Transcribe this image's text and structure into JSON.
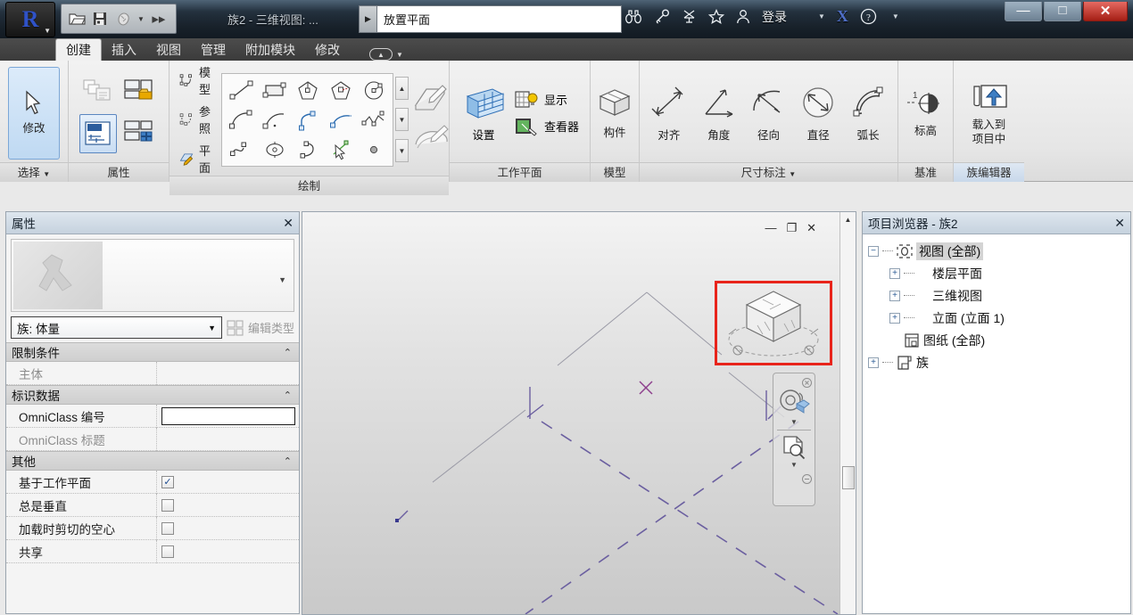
{
  "titlebar": {
    "window_title": "族2 - 三维视图: ...",
    "search_value": "放置平面",
    "signin_label": "登录",
    "quick_access": [
      {
        "name": "open-icon",
        "glyph": "📂"
      },
      {
        "name": "save-icon",
        "glyph": "💾"
      },
      {
        "name": "undo-icon",
        "glyph": "☁"
      }
    ],
    "tools": [
      {
        "name": "search-binoculars-icon",
        "glyph": "🔍"
      },
      {
        "name": "key-icon",
        "glyph": "🔑"
      },
      {
        "name": "satellite-icon",
        "glyph": "⚑"
      },
      {
        "name": "star-icon",
        "glyph": "☆"
      },
      {
        "name": "user-icon",
        "glyph": "👤"
      }
    ],
    "exchange_label": "X",
    "help_label": "?",
    "window_buttons": {
      "minimize": "—",
      "maximize": "□",
      "close": "✕"
    }
  },
  "ribbon": {
    "tabs": [
      {
        "label": "创建",
        "active": true
      },
      {
        "label": "插入",
        "active": false
      },
      {
        "label": "视图",
        "active": false
      },
      {
        "label": "管理",
        "active": false
      },
      {
        "label": "附加模块",
        "active": false
      },
      {
        "label": "修改",
        "active": false
      }
    ],
    "panels": {
      "select": {
        "label": "选择",
        "has_dropdown": true,
        "modify_button": "修改"
      },
      "properties": {
        "label": "属性"
      },
      "draw": {
        "label": "绘制",
        "items": [
          {
            "label": "模型",
            "icon": "model-line-icon"
          },
          {
            "label": "参照",
            "icon": "reference-line-icon"
          },
          {
            "label": "平面",
            "icon": "plane-icon"
          }
        ]
      },
      "workplane": {
        "label": "工作平面",
        "set_label": "设置",
        "show_label": "显示",
        "viewer_label": "查看器"
      },
      "model": {
        "label": "模型",
        "component_label": "构件"
      },
      "dimension": {
        "label": "尺寸标注",
        "has_dropdown": true,
        "items": [
          "对齐",
          "角度",
          "径向",
          "直径",
          "弧长"
        ]
      },
      "datum": {
        "label": "基准",
        "level_label": "标高"
      },
      "family_editor": {
        "label": "族编辑器",
        "load_label_line1": "载入到",
        "load_label_line2": "项目中"
      }
    }
  },
  "properties_palette": {
    "title": "属性",
    "close_label": "✕",
    "family_selector": "族: 体量",
    "edit_type_label": "编辑类型",
    "sections": [
      {
        "title": "限制条件",
        "rows": [
          {
            "key": "主体",
            "type": "text",
            "value": "",
            "dim": true
          }
        ]
      },
      {
        "title": "标识数据",
        "rows": [
          {
            "key": "OmniClass 编号",
            "type": "input",
            "value": "",
            "dim": false
          },
          {
            "key": "OmniClass 标题",
            "type": "text",
            "value": "",
            "dim": true
          }
        ]
      },
      {
        "title": "其他",
        "rows": [
          {
            "key": "基于工作平面",
            "type": "checkbox",
            "checked": true,
            "dim": false
          },
          {
            "key": "总是垂直",
            "type": "checkbox",
            "checked": false,
            "dim": false
          },
          {
            "key": "加载时剪切的空心",
            "type": "checkbox",
            "checked": false,
            "dim": false
          },
          {
            "key": "共享",
            "type": "checkbox",
            "checked": false,
            "dim": false
          }
        ]
      }
    ]
  },
  "viewport": {
    "controls": [
      {
        "name": "minimize-view-icon",
        "glyph": "—"
      },
      {
        "name": "restore-view-icon",
        "glyph": "❐"
      },
      {
        "name": "close-view-icon",
        "glyph": "✕"
      }
    ],
    "highlight_color": "#e8241b",
    "navigation_bar": {
      "steering_wheel": "steering-wheel-icon",
      "zoom_tool": "zoom-region-icon"
    }
  },
  "project_browser": {
    "title": "项目浏览器 - 族2",
    "close_label": "✕",
    "tree": [
      {
        "label": "视图 (全部)",
        "level": 0,
        "expander": "−",
        "icon": "views-icon",
        "selected": true
      },
      {
        "label": "楼层平面",
        "level": 1,
        "expander": "+",
        "icon": "none",
        "selected": false
      },
      {
        "label": "三维视图",
        "level": 1,
        "expander": "+",
        "icon": "none",
        "selected": false
      },
      {
        "label": "立面 (立面 1)",
        "level": 1,
        "expander": "+",
        "icon": "none",
        "selected": false
      },
      {
        "label": "图纸 (全部)",
        "level": 0,
        "expander": "",
        "icon": "sheets-icon",
        "selected": false
      },
      {
        "label": "族",
        "level": 0,
        "expander": "+",
        "icon": "family-icon",
        "selected": false
      }
    ]
  }
}
